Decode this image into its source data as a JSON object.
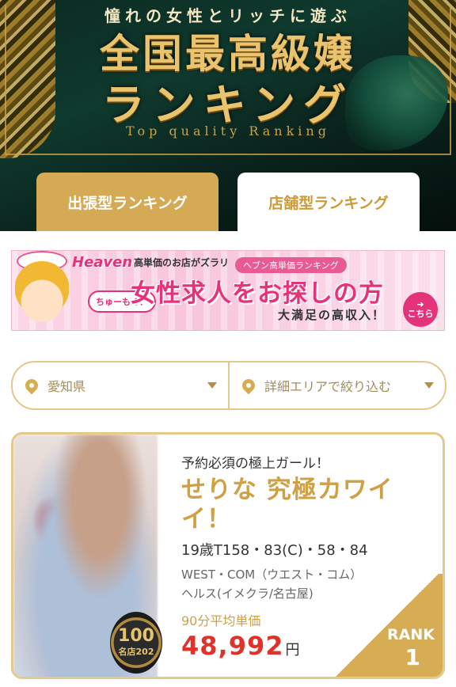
{
  "hero": {
    "subtitle": "憧れの女性とリッチに遊ぶ",
    "title_line1": "全国最高級嬢",
    "title_line2": "ランキング",
    "title_en": "Top quality Ranking"
  },
  "tabs": [
    {
      "label": "出張型ランキング",
      "active": true
    },
    {
      "label": "店舗型ランキング",
      "active": false
    }
  ],
  "banner": {
    "logo": "Heaven",
    "tagline": "高単価のお店がズラリ",
    "tag_pill": "ヘブン高単価ランキング",
    "bubble": "ちゅーもく！",
    "headline": "女性求人をお探しの方",
    "footer": "大満足の高収入！",
    "cta": "こちら"
  },
  "filter": {
    "prefecture": "愛知県",
    "area": "詳細エリアで絞り込む"
  },
  "card": {
    "catchphrase": "予約必須の極上ガール！",
    "name": "せりな 究極カワイイ！",
    "stats": "19歳T158・83(C)・58・84",
    "shop": "WEST・COM（ウエスト・コム）",
    "category": "ヘルス(イメクラ/名古屋)",
    "price_label": "90分平均単価",
    "price": "48,992",
    "price_unit": "円",
    "rank_label": "RANK",
    "rank_number": "1",
    "badge_number": "100",
    "badge_text": "名店202"
  },
  "colors": {
    "gold": "#d4aa55",
    "price_red": "#e0312b",
    "banner_pink": "#e4327b",
    "hero_green": "#0f3a2e"
  }
}
